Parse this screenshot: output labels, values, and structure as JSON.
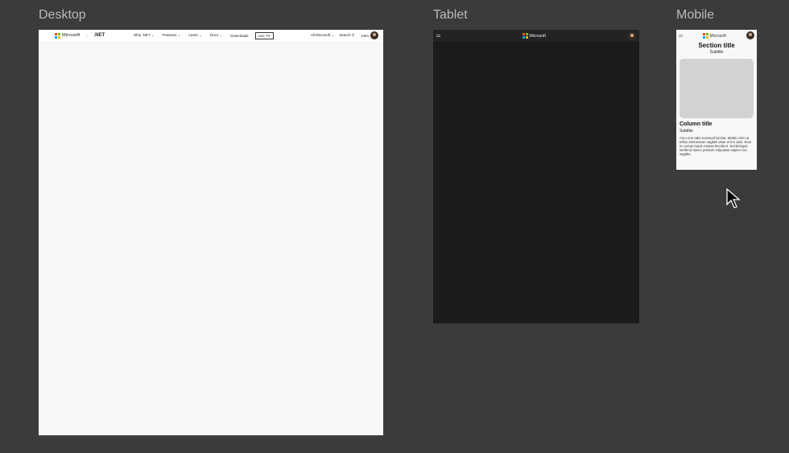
{
  "frames": {
    "desktop": "Desktop",
    "tablet": "Tablet",
    "mobile": "Mobile"
  },
  "brand": {
    "name": "Microsoft",
    "product": ".NET",
    "colors": [
      "#f25022",
      "#7fba00",
      "#00a4ef",
      "#ffb900"
    ]
  },
  "desktop_nav": {
    "items": [
      "Why .NET",
      "Features",
      "Learn",
      "Docs"
    ],
    "downloads": "Downloads",
    "live_tv": "Live TV",
    "all_microsoft": "All Microsoft",
    "search": "Search",
    "user": "John"
  },
  "mobile": {
    "section_title": "Section title",
    "section_subtitle": "Subtitle",
    "column_title": "Column title",
    "column_subtitle": "Subtitle",
    "body": "Arcu non odio euismod lacinia. Mattis enim ut tellus elementum sagittis vitae et leo duis. Eros in cursus turpis massa tincidunt. Scelerisque eleifend donec pretium vulputate sapien nec sagittis."
  }
}
